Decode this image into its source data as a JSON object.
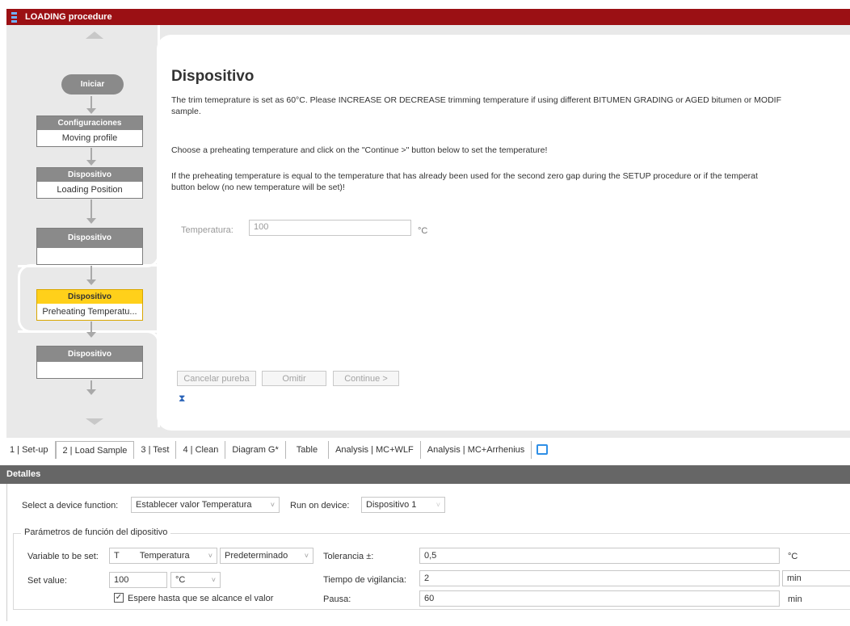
{
  "window": {
    "title": "LOADING procedure"
  },
  "flow": {
    "start": "Iniciar",
    "nodes": [
      {
        "head": "Configuraciones",
        "body": "Moving profile"
      },
      {
        "head": "Dispositivo",
        "body": "Loading Position"
      },
      {
        "head": "Dispositivo",
        "body": ""
      },
      {
        "head": "Dispositivo",
        "body": "Preheating Temperatu..."
      },
      {
        "head": "Dispositivo",
        "body": ""
      }
    ]
  },
  "content": {
    "heading": "Dispositivo",
    "para1_line1": "The trim temeprature is set as 60°C. Please INCREASE OR DECREASE trimming temperature if using different BITUMEN GRADING or AGED bitumen or MODIF",
    "para1_line2": "sample.",
    "para2": "Choose a preheating temperature and click on the \"Continue >\" button below to set the temperature!",
    "para3_line1": "If the preheating temperature is equal to the temperature that has already been used for the second zero gap during the SETUP procedure or if the temperat",
    "para3_line2": "button below (no new temperature will be set)!",
    "temp_label": "Temperatura:",
    "temp_value": "100",
    "temp_unit": "°C",
    "buttons": {
      "cancel": "Cancelar pureba",
      "skip": "Omitir",
      "continue": "Continue >"
    }
  },
  "tabs": [
    "1 | Set-up",
    "2 | Load Sample",
    "3 | Test",
    "4 | Clean",
    "Diagram G*",
    "Table",
    "Analysis | MC+WLF",
    "Analysis | MC+Arrhenius"
  ],
  "details": {
    "title": "Detalles",
    "device_function_label": "Select a device function:",
    "device_function_value": "Establecer valor Temperatura",
    "run_on_label": "Run on device:",
    "run_on_value": "Dispositivo 1",
    "group_label": "Parámetros de función del dipositivo",
    "variable_label": "Variable to be set:",
    "variable_symbol": "T",
    "variable_value": "Temperatura",
    "variable_mode": "Predeterminado",
    "set_value_label": "Set value:",
    "set_value": "100",
    "set_unit": "°C",
    "wait_label": "Espere hasta que se alcance el valor",
    "tolerance_label": "Tolerancia ±:",
    "tolerance_value": "0,5",
    "tolerance_unit": "°C",
    "watch_label": "Tiempo de vigilancia:",
    "watch_value": "2",
    "watch_unit": "min",
    "pause_label": "Pausa:",
    "pause_value": "60",
    "pause_unit": "min"
  },
  "colors": {
    "titlebar": "#9b1014",
    "active_node": "#ffd01a",
    "node_head": "#8a8a8a",
    "details_bar": "#666666"
  }
}
